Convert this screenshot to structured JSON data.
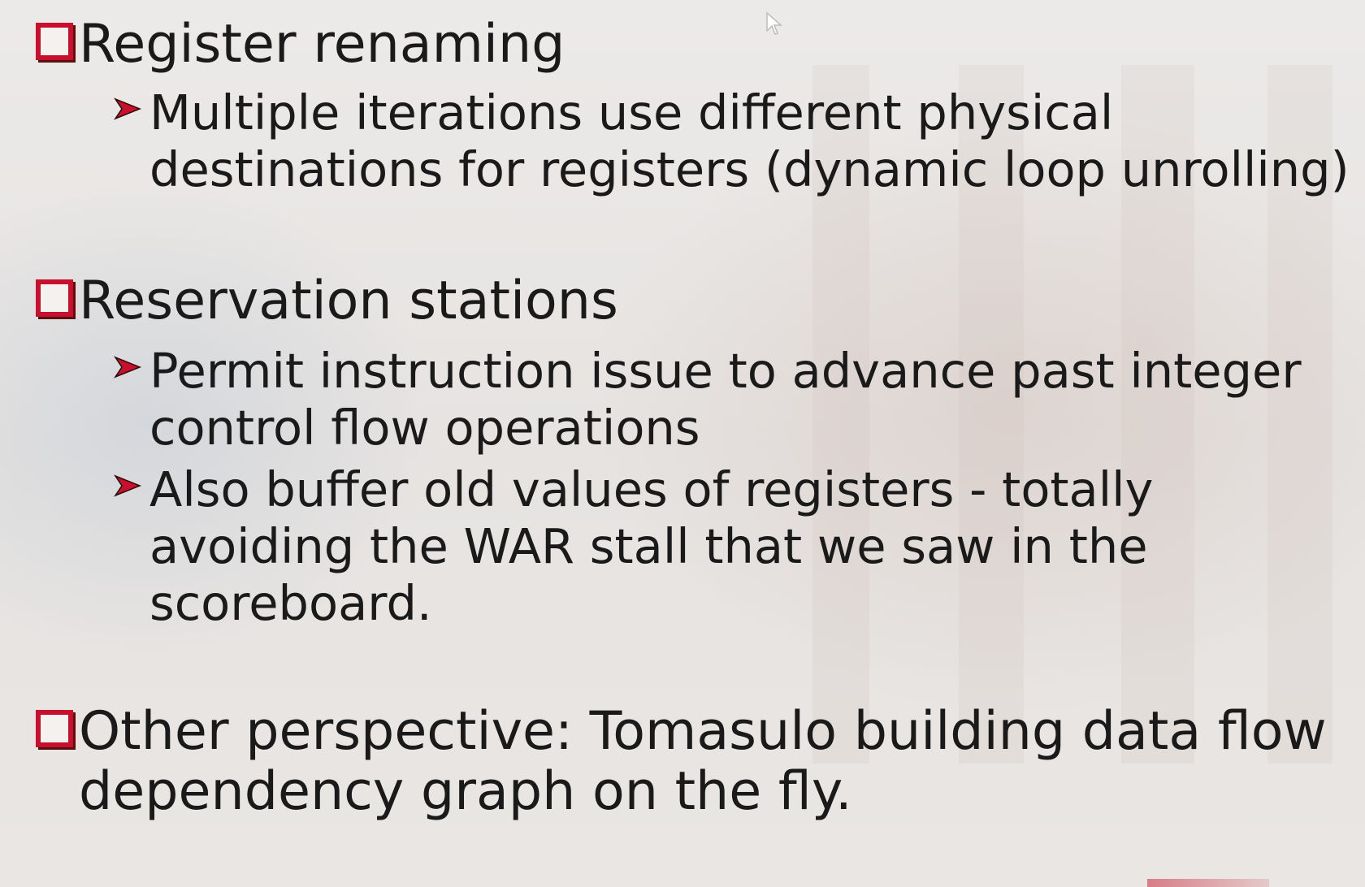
{
  "slide": {
    "bullets": [
      {
        "text": "Register renaming",
        "subs": [
          "Multiple iterations use different physical\ndestinations for registers (dynamic loop unrolling)"
        ]
      },
      {
        "text": "Reservation stations",
        "subs": [
          "Permit instruction issue to advance past integer\ncontrol flow operations",
          "Also buffer old values of registers - totally\navoiding the WAR stall that we saw in the\nscoreboard."
        ]
      },
      {
        "text": "Other perspective: Tomasulo building data flow dependency graph on the fly."
      }
    ]
  },
  "icons": {
    "level1": "checkbox-square-icon",
    "level2": "arrowhead-bullet-icon",
    "pointer": "mouse-cursor-icon"
  },
  "colors": {
    "accent": "#c8102e",
    "text": "#1a1a1a",
    "background": "#e9e7e5"
  }
}
